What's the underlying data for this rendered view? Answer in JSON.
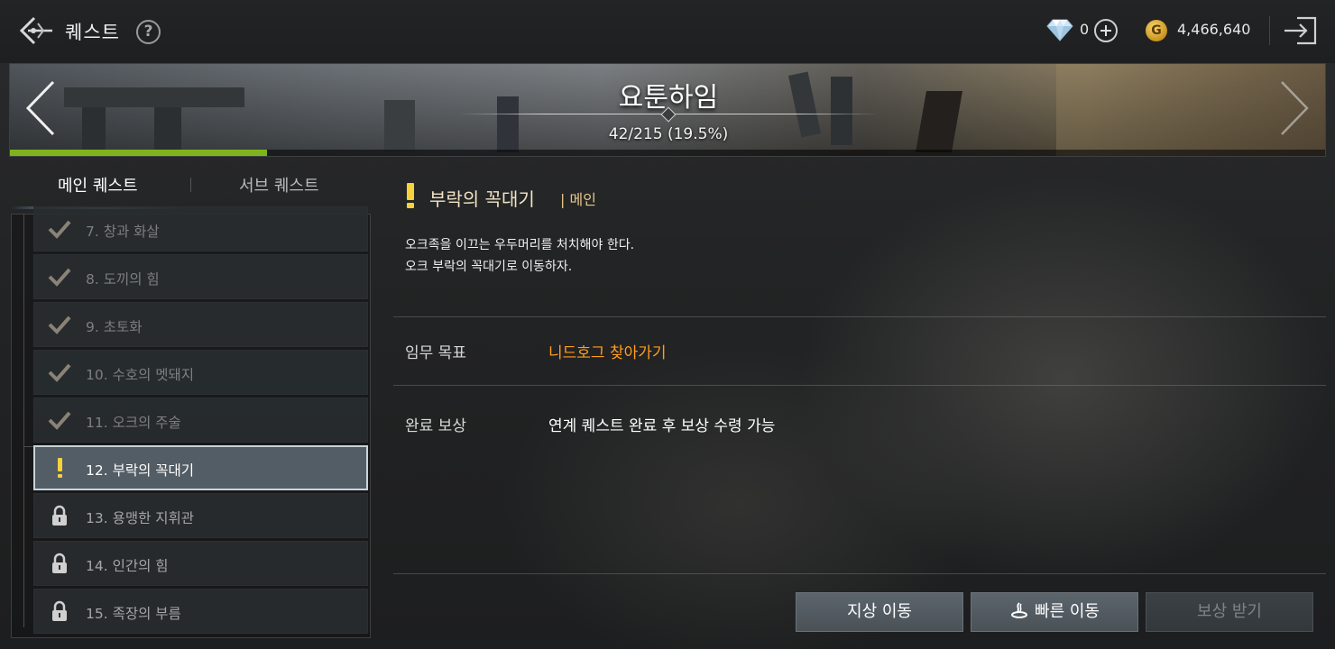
{
  "header": {
    "title": "퀘스트",
    "help_icon": "?",
    "gem_count": "0",
    "gold_icon_letter": "G",
    "gold_count": "4,466,640"
  },
  "banner": {
    "region_name": "요툰하임",
    "progress_text": "42/215 (19.5%)",
    "progress_fraction": 0.195
  },
  "tabs": {
    "main_label": "메인 퀘스트",
    "sub_label": "서브 퀘스트"
  },
  "quest_list": [
    {
      "label": "7. 창과 화살",
      "status": "done"
    },
    {
      "label": "8. 도끼의 힘",
      "status": "done"
    },
    {
      "label": "9. 초토화",
      "status": "done"
    },
    {
      "label": "10. 수호의 멧돼지",
      "status": "done"
    },
    {
      "label": "11. 오크의 주술",
      "status": "done"
    },
    {
      "label": "12. 부락의 꼭대기",
      "status": "active"
    },
    {
      "label": "13. 용맹한 지휘관",
      "status": "locked"
    },
    {
      "label": "14. 인간의 힘",
      "status": "locked"
    },
    {
      "label": "15. 족장의 부름",
      "status": "locked"
    }
  ],
  "detail": {
    "title": "부락의 꼭대기",
    "type": "| 메인",
    "desc_line1": "오크족을 이끄는 우두머리를 처치해야 한다.",
    "desc_line2": "오크 부락의 꼭대기로 이동하자.",
    "objective_label": "임무 목표",
    "objective_value": "니드호그 찾아가기",
    "reward_label": "완료 보상",
    "reward_value": "연계 퀘스트 완료 후 보상 수령 가능"
  },
  "buttons": {
    "ground_move": "지상 이동",
    "fast_move": "빠른 이동",
    "claim_reward": "보상 받기"
  },
  "colors": {
    "progress": "#7fb31d",
    "objective": "#ff9d1e",
    "active_item": "#535d66",
    "exclamation": "#f6d23c"
  }
}
